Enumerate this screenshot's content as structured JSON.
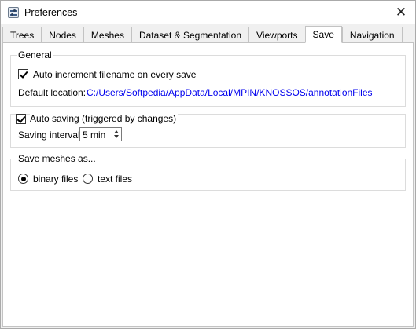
{
  "window": {
    "title": "Preferences",
    "app_icon": "settings-app-icon",
    "close_icon": "close-icon"
  },
  "tabs": [
    {
      "label": "Trees",
      "active": false
    },
    {
      "label": "Nodes",
      "active": false
    },
    {
      "label": "Meshes",
      "active": false
    },
    {
      "label": "Dataset & Segmentation",
      "active": false
    },
    {
      "label": "Viewports",
      "active": false
    },
    {
      "label": "Save",
      "active": true
    },
    {
      "label": "Navigation",
      "active": false
    }
  ],
  "general": {
    "title": "General",
    "auto_increment": {
      "label": "Auto increment filename on every save",
      "checked": true
    },
    "default_location_label": "Default location:",
    "default_location_path": "C:/Users/Softpedia/AppData/Local/MPIN/KNOSSOS/annotationFiles"
  },
  "autosave": {
    "checkbox": {
      "label": "Auto saving (triggered by changes)",
      "checked": true
    },
    "interval_label": "Saving interval",
    "interval_value": "5 min"
  },
  "meshes": {
    "title": "Save meshes as...",
    "options": [
      {
        "label": "binary files",
        "selected": true
      },
      {
        "label": "text files",
        "selected": false
      }
    ]
  }
}
